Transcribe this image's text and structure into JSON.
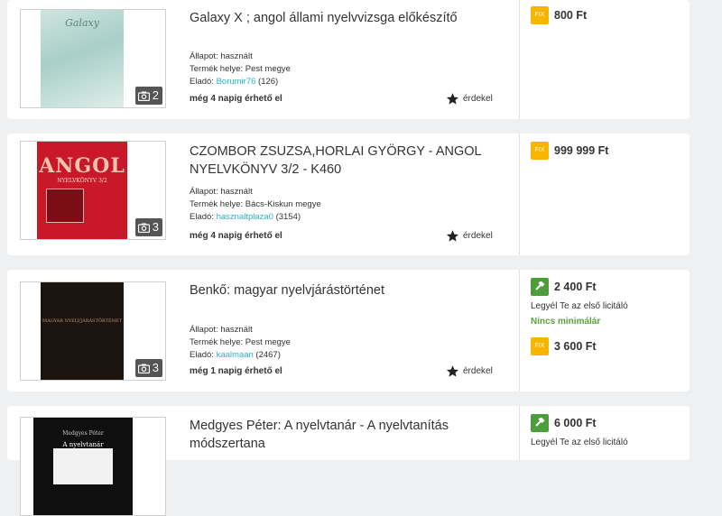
{
  "labels": {
    "condition_prefix": "Állapot: ",
    "location_prefix": "Termék helye: ",
    "seller_prefix": "Eladó: ",
    "watch": "érdekel",
    "fix": "FIX",
    "first_bidder": "Legyél Te az első licitáló",
    "no_minimum": "Nincs minimálár"
  },
  "listings": [
    {
      "title": "Galaxy X ; angol állami nyelvvizsga előkészítő",
      "cover_text": "Galaxy",
      "photo_count": "2",
      "condition": "használt",
      "location": "Pest megye",
      "seller": "Borumir76",
      "seller_rating": " (126)",
      "availability": "még 4 napig érhető el",
      "fix_price": "800 Ft"
    },
    {
      "title": "CZOMBOR ZSUZSA,HORLAI GYÖRGY - ANGOL NYELVKÖNYV 3/2 - K460",
      "cover_text": "ANGOL",
      "cover_subtext": "NYELVKÖNYV 3/2",
      "photo_count": "3",
      "condition": "használt",
      "location": "Bács-Kiskun megye",
      "seller": "hasznaltplaza0",
      "seller_rating": " (3154)",
      "availability": "még 4 napig érhető el",
      "fix_price": "999 999 Ft"
    },
    {
      "title": "Benkő: magyar nyelvjárástörténet",
      "cover_text": "MAGYAR NYELVJÁRÁSTÖRTÉNET",
      "photo_count": "3",
      "condition": "használt",
      "location": "Pest megye",
      "seller": "kaalmaan",
      "seller_rating": " (2467)",
      "availability": "még 1 napig érhető el",
      "bid_price": "2 400 Ft",
      "fix_price": "3 600 Ft"
    },
    {
      "title": "Medgyes Péter: A nyelvtanár - A nyelvtanítás módszertana",
      "cover_text_top": "Medgyes Péter",
      "cover_text": "A nyelvtanár",
      "bid_price": "6 000 Ft"
    }
  ]
}
